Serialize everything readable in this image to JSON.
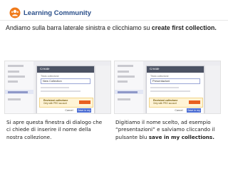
{
  "header": {
    "brand": "Learning Community"
  },
  "heading": {
    "text": "Andiamo sulla barra laterale sinistra e clicchiamo su  ",
    "bold": "create first collection."
  },
  "screenshots": [
    {
      "dialog_title": "Create",
      "field_label": "Titolo collezione",
      "field_value": "New Collection",
      "warning_title": "Revisioni collezione",
      "warning_body": "Only with PRO account",
      "cancel": "Cancel",
      "save": "Save in my coll."
    },
    {
      "dialog_title": "Create",
      "field_label": "Titolo collezione",
      "field_value": "Presentazioni",
      "warning_title": "Revisioni collezione",
      "warning_body": "Only with PRO account",
      "cancel": "Cancel",
      "save": "Save in my coll."
    }
  ],
  "captions": {
    "left": "Si apre questa finestra di dialogo che ci chiede di inserire il nome della nostra collezione.",
    "right_text": "Digitiamo il nome scelto, ad esempio “presentazioni” e salviamo cliccando il pulsante blu ",
    "right_bold": "save in my collections."
  },
  "colors": {
    "brand": "#2a4f8a",
    "logo_orange": "#f07a1a",
    "save_blue": "#4a6cd4",
    "warning_bg": "#fff4d6"
  }
}
